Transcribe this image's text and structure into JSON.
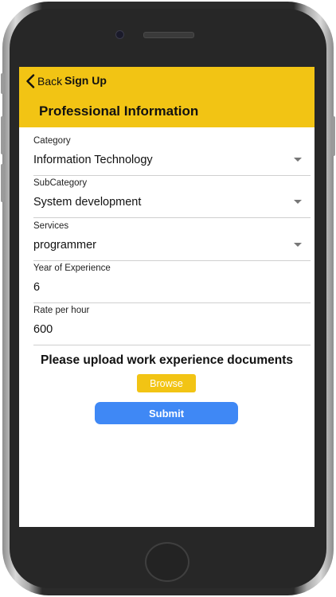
{
  "header": {
    "back_label": "Back",
    "nav_title": "Sign Up",
    "page_title": "Professional Information"
  },
  "form": {
    "category": {
      "label": "Category",
      "value": "Information Technology"
    },
    "subcategory": {
      "label": "SubCategory",
      "value": "System development"
    },
    "services": {
      "label": "Services",
      "value": "programmer"
    },
    "experience": {
      "label": "Year of Experience",
      "value": "6"
    },
    "rate": {
      "label": "Rate per hour",
      "value": "600"
    }
  },
  "upload": {
    "prompt": "Please upload work experience documents",
    "browse_label": "Browse"
  },
  "submit_label": "Submit",
  "colors": {
    "header_bg": "#f2c414",
    "browse_bg": "#f2c414",
    "submit_bg": "#3f88f5"
  },
  "icons": {
    "back": "chevron-left-icon",
    "dropdown": "caret-down-icon"
  }
}
